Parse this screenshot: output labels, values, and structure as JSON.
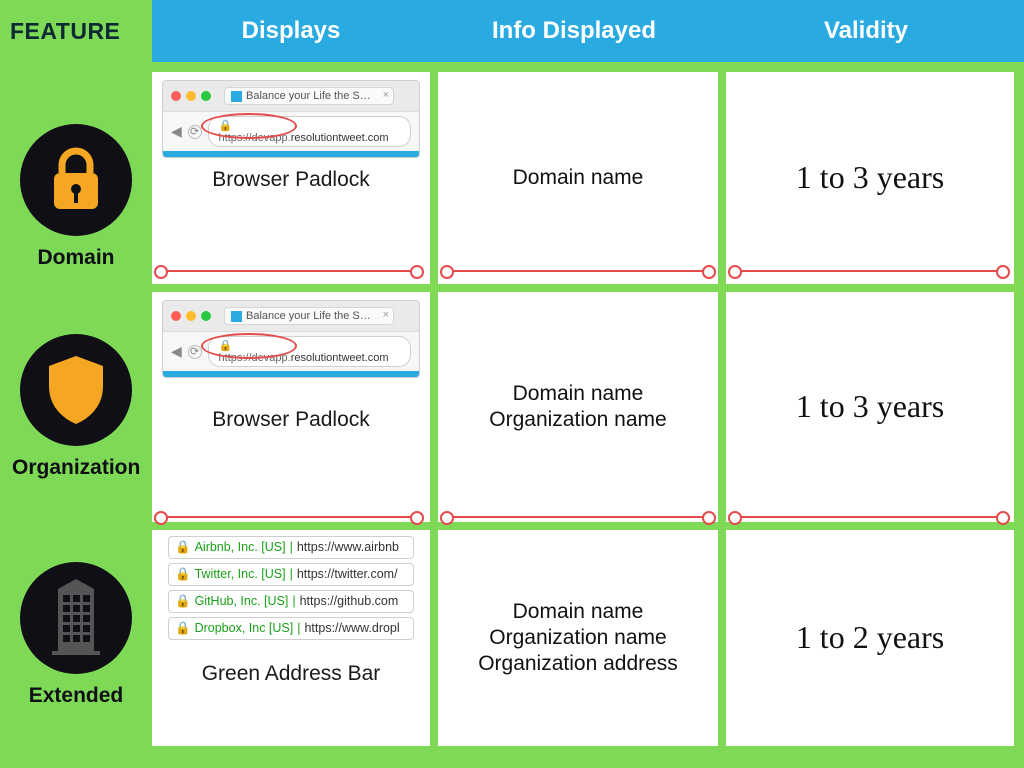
{
  "header": {
    "feature": "FEATURE",
    "cols": {
      "displays": "Displays",
      "info": "Info Displayed",
      "validity": "Validity"
    }
  },
  "browser_sample": {
    "tab_title": "Balance your Life the Social ...",
    "https_sep": "|",
    "host_bold": "resolutiontweet.com",
    "protocol": "https://",
    "subdomain": "devapp."
  },
  "rows": [
    {
      "feature_label": "Domain",
      "displays_caption": "Browser Padlock",
      "info": [
        "Domain name"
      ],
      "validity": "1 to 3 years"
    },
    {
      "feature_label": "Organization",
      "displays_caption": "Browser Padlock",
      "info": [
        "Domain name",
        "Organization name"
      ],
      "validity": "1 to 3 years"
    },
    {
      "feature_label": "Extended",
      "displays_caption": "Green Address Bar",
      "info": [
        "Domain name",
        "Organization name",
        "Organization address"
      ],
      "validity": "1 to 2 years",
      "ev_rows": [
        {
          "org": "Airbnb, Inc. [US]",
          "url": "https://www.airbnb"
        },
        {
          "org": "Twitter, Inc. [US]",
          "url": "https://twitter.com/"
        },
        {
          "org": "GitHub, Inc. [US]",
          "url": "https://github.com"
        },
        {
          "org": "Dropbox, Inc [US]",
          "url": "https://www.dropl"
        }
      ]
    }
  ],
  "chart_data": {
    "type": "table",
    "title": "SSL Certificate Types Comparison",
    "columns": [
      "FEATURE",
      "Displays",
      "Info Displayed",
      "Validity"
    ],
    "rows": [
      [
        "Domain",
        "Browser Padlock",
        "Domain name",
        "1 to 3 years"
      ],
      [
        "Organization",
        "Browser Padlock",
        "Domain name; Organization name",
        "1 to 3 years"
      ],
      [
        "Extended",
        "Green Address Bar",
        "Domain name; Organization name; Organization address",
        "1 to 2 years"
      ]
    ]
  }
}
